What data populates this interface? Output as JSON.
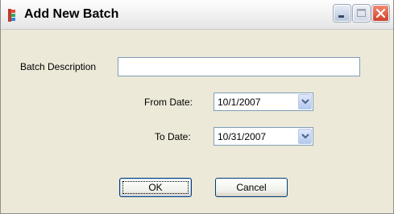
{
  "window": {
    "title": "Add New Batch"
  },
  "titlebar_buttons": {
    "minimize_icon": "minimize-icon",
    "maximize_icon": "maximize-icon",
    "close_icon": "close-icon"
  },
  "form": {
    "batch_description_label": "Batch Description",
    "batch_description_value": "",
    "from_date_label": "From Date:",
    "from_date_value": "10/1/2007",
    "to_date_label": "To Date:",
    "to_date_value": "10/31/2007"
  },
  "buttons": {
    "ok_label": "OK",
    "cancel_label": "Cancel"
  },
  "colors": {
    "close_button": "#d0402a",
    "window_background": "#ece9d8",
    "input_border": "#7f9db9"
  }
}
